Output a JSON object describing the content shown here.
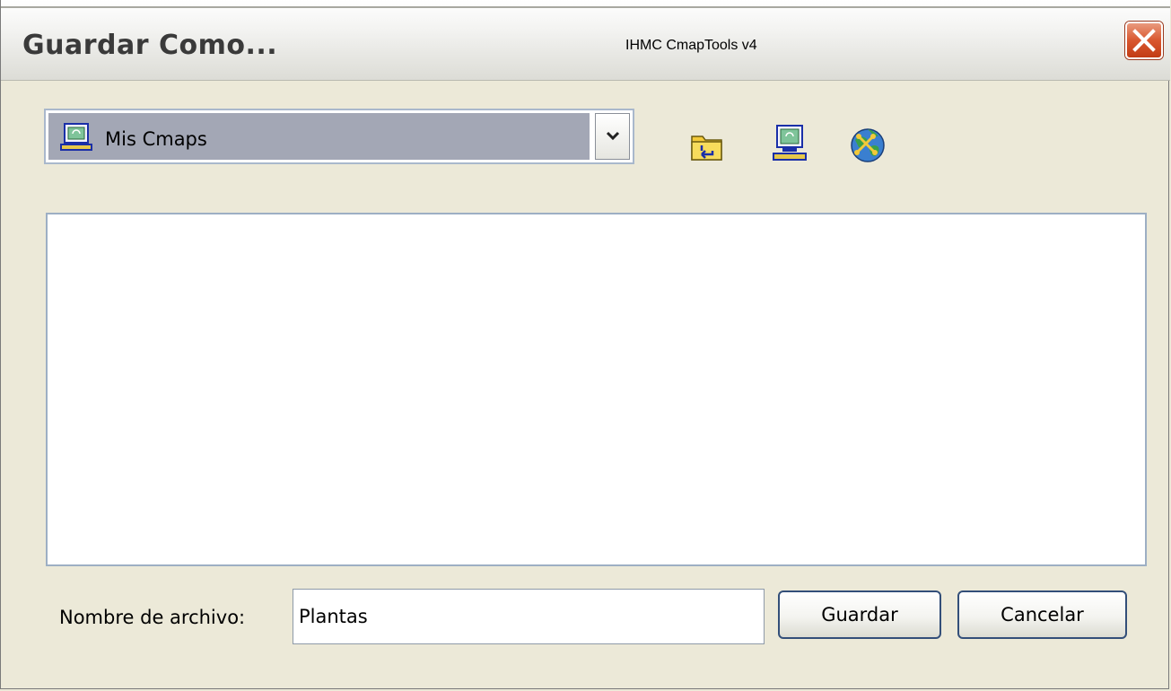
{
  "window": {
    "title": "Guardar Como...",
    "app_name": "IHMC CmapTools v4"
  },
  "location": {
    "selected": "Mis Cmaps",
    "icon": "computer-icon"
  },
  "toolbar": {
    "icons": [
      "folder-up-icon",
      "computer-icon",
      "globe-icon"
    ]
  },
  "file_list": {
    "items": []
  },
  "filename": {
    "label": "Nombre de archivo:",
    "value": "Plantas"
  },
  "buttons": {
    "save_label": "Guardar",
    "cancel_label": "Cancelar"
  },
  "colors": {
    "window_bg": "#ece9d8",
    "selection_bg": "#a3a7b5",
    "close_red": "#d9572f",
    "button_border": "#334f79"
  }
}
